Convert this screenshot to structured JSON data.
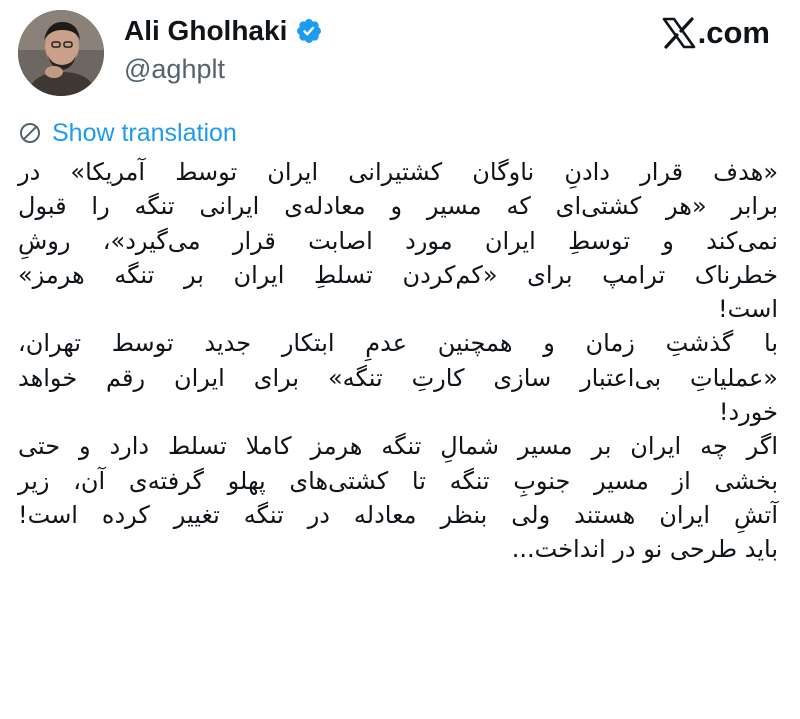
{
  "author": {
    "display_name": "Ali Gholhaki",
    "handle": "@aghplt",
    "verified": true,
    "avatar_icon": "profile-photo"
  },
  "brand": {
    "text": "𝕏.com",
    "label": ".com"
  },
  "translate": {
    "label": "Show translation",
    "icon": "globe-icon"
  },
  "colors": {
    "link": "#1d9bf0",
    "verified": "#1d9bf0",
    "secondary_text": "#536471",
    "text": "#0f1419"
  },
  "tweet": {
    "lines": [
      "«هدف قرار دادنِ ناوگان کشتیرانی ایران توسط آمریکا» در",
      "برابر «هر کشتی‌ای که مسیر و معادله‌ی ایرانی تنگه را قبول",
      "نمی‌کند و توسطِ ایران مورد اصابت قرار می‌گیرد»، روشِ",
      "خطرناک ترامپ برای «کم‌کردن تسلطِ ایران بر تنگه هرمز»",
      "است!",
      "با گذشتِ زمان و همچنین عدمِ ابتکار جدید توسط تهران،",
      "«عملیاتِ بی‌اعتبار سازی کارتِ تنگه» برای ایران رقم خواهد",
      "خورد!",
      "اگر چه ایران بر مسیر شمالِ تنگه هرمز کاملا تسلط دارد و حتی",
      "بخشی از مسیر جنوبِ تنگه تا کشتی‌های پهلو گرفته‌ی آن، زیر",
      "آتشِ ایران هستند ولی بنظر معادله در تنگه تغییر کرده است!",
      "باید طرحی نو در انداخت..."
    ]
  }
}
